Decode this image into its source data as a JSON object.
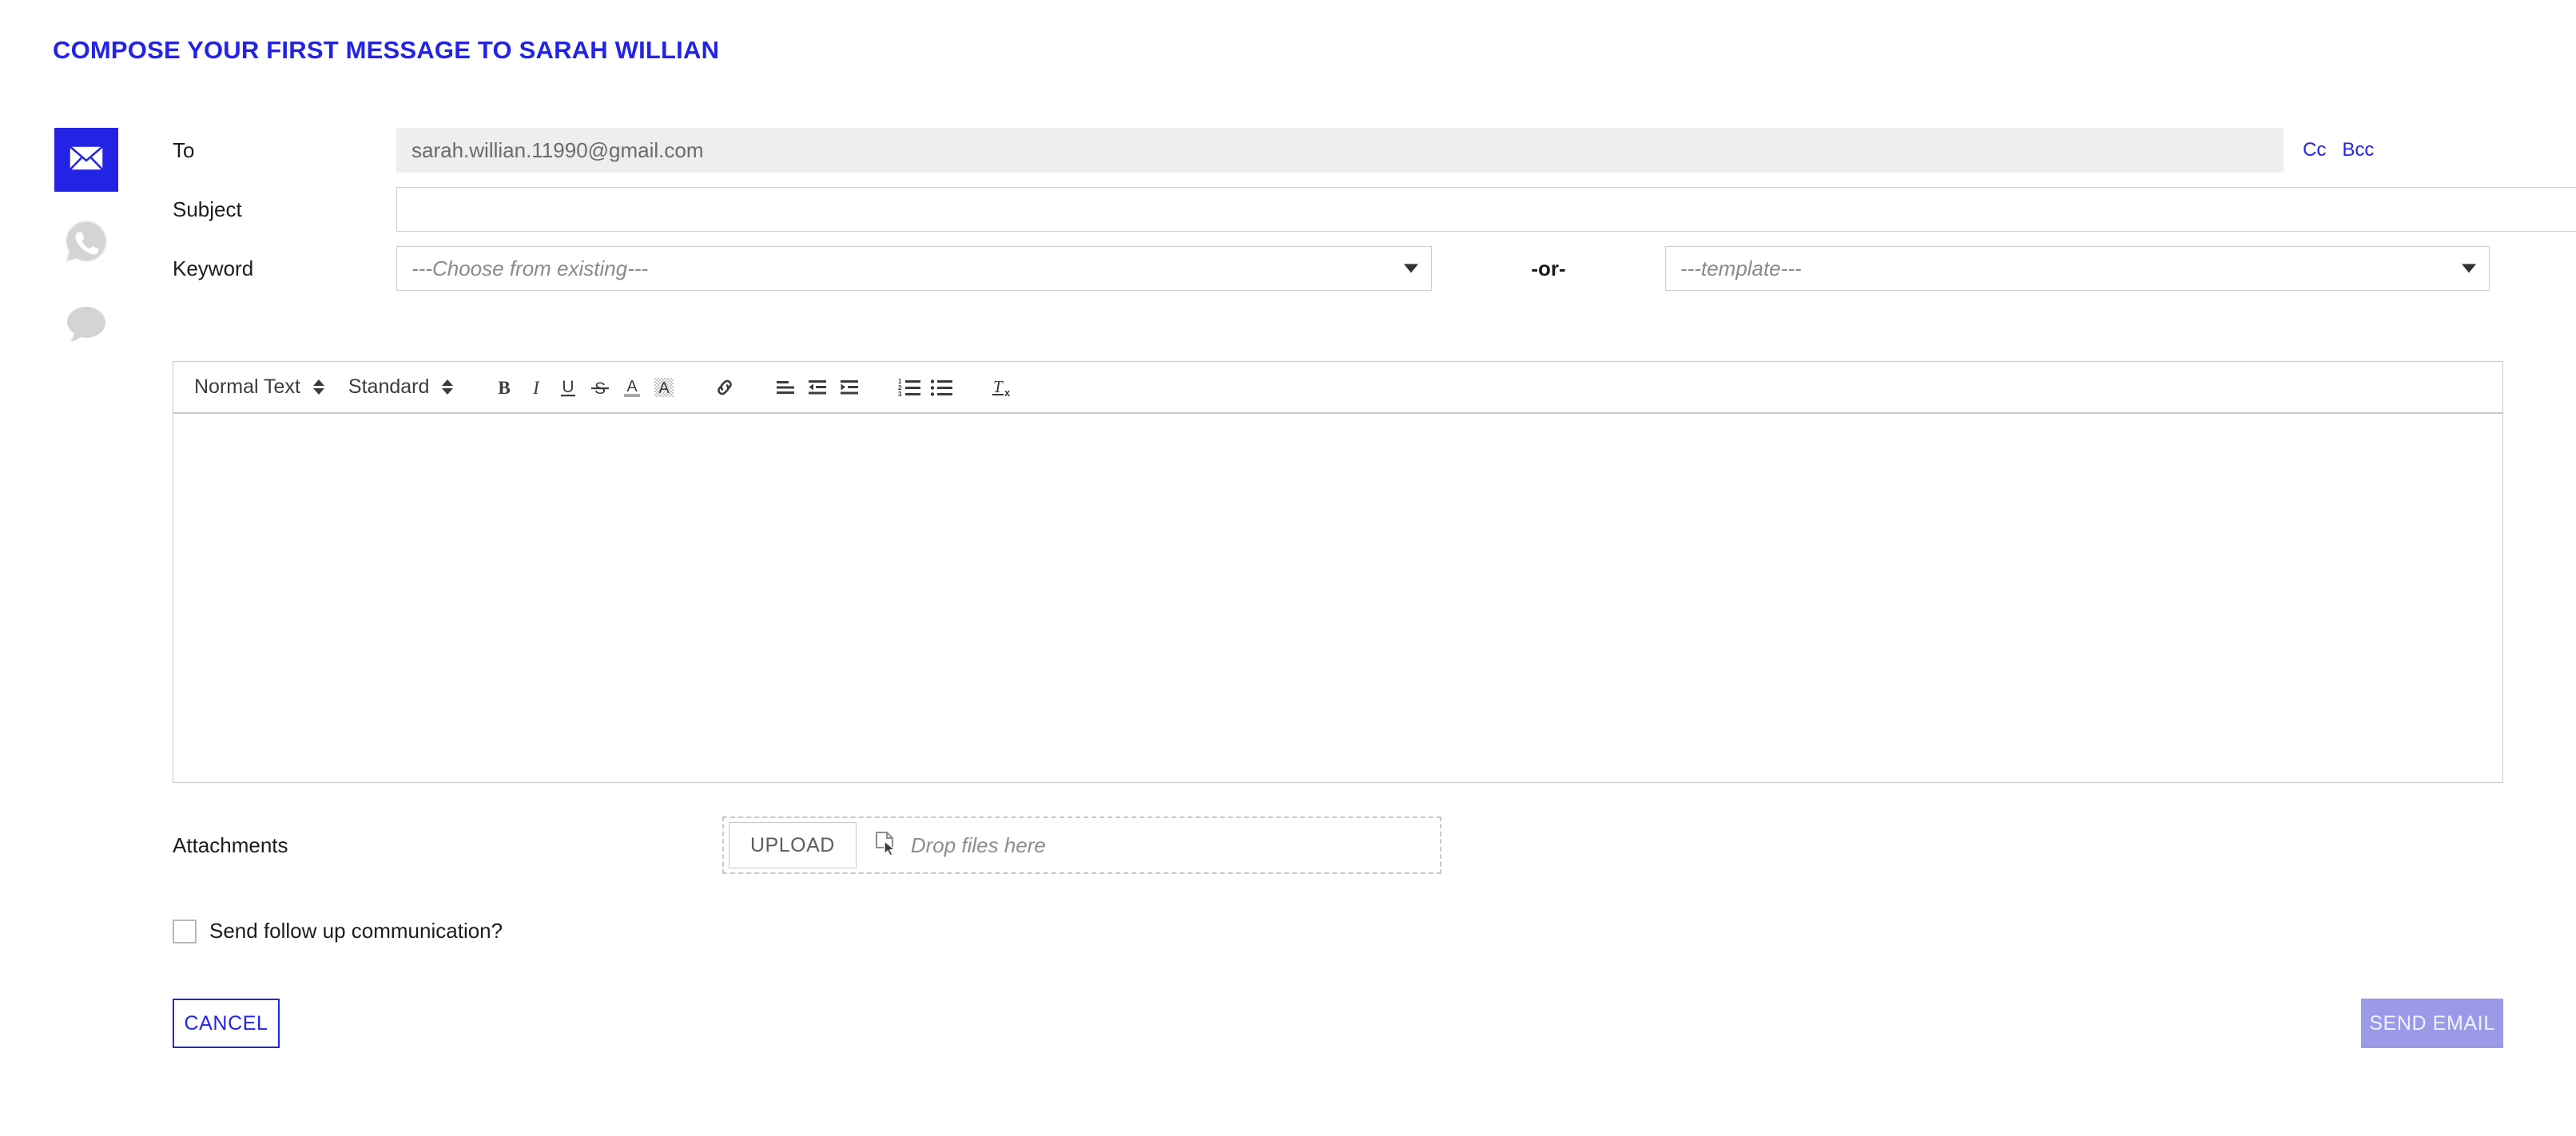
{
  "header": {
    "title": "COMPOSE YOUR FIRST MESSAGE TO SARAH WILLIAN",
    "title_color": "#2323e6"
  },
  "channels": [
    {
      "name": "email",
      "icon": "envelope-icon",
      "active": true
    },
    {
      "name": "whatsapp",
      "icon": "whatsapp-icon",
      "active": false
    },
    {
      "name": "sms",
      "icon": "chat-bubble-icon",
      "active": false
    }
  ],
  "form": {
    "to": {
      "label": "To",
      "value": "sarah.willian.11990@gmail.com",
      "readonly": true,
      "cc_label": "Cc",
      "bcc_label": "Bcc"
    },
    "subject": {
      "label": "Subject",
      "value": "",
      "placeholder": ""
    },
    "keyword": {
      "label": "Keyword",
      "selected": "---Choose from existing---",
      "separator": "-or-",
      "template_selected": "---template---"
    }
  },
  "editor": {
    "style_select": "Normal Text",
    "size_select": "Standard",
    "buttons": [
      {
        "name": "bold-icon",
        "title": "Bold"
      },
      {
        "name": "italic-icon",
        "title": "Italic"
      },
      {
        "name": "underline-icon",
        "title": "Underline"
      },
      {
        "name": "strikethrough-icon",
        "title": "Strikethrough"
      },
      {
        "name": "text-color-icon",
        "title": "Text color"
      },
      {
        "name": "highlight-color-icon",
        "title": "Highlight color"
      },
      {
        "name": "link-icon",
        "title": "Insert link"
      },
      {
        "name": "align-icon",
        "title": "Align"
      },
      {
        "name": "outdent-icon",
        "title": "Outdent"
      },
      {
        "name": "indent-icon",
        "title": "Indent"
      },
      {
        "name": "ordered-list-icon",
        "title": "Numbered list"
      },
      {
        "name": "unordered-list-icon",
        "title": "Bulleted list"
      },
      {
        "name": "clear-format-icon",
        "title": "Clear formatting"
      }
    ],
    "body": ""
  },
  "attachments": {
    "label": "Attachments",
    "upload_label": "UPLOAD",
    "drop_hint": "Drop files here"
  },
  "followup": {
    "label": "Send follow up communication?",
    "checked": false
  },
  "footer": {
    "cancel_label": "CANCEL",
    "send_label": "SEND EMAIL",
    "send_color": "#9a9ae8",
    "cancel_color": "#2323e6"
  }
}
